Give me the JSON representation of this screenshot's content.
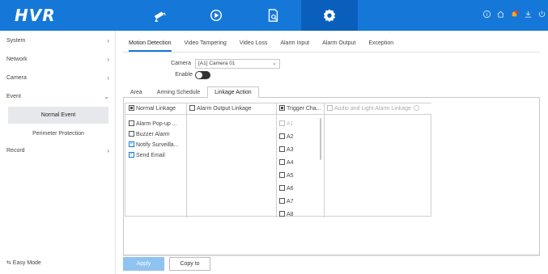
{
  "app": {
    "logo": "HVR"
  },
  "topnav": {
    "items": [
      {
        "icon": "camera-icon",
        "active": false
      },
      {
        "icon": "playback-icon",
        "active": false
      },
      {
        "icon": "file-search-icon",
        "active": false
      },
      {
        "icon": "gear-icon",
        "active": true
      }
    ],
    "right_icons": [
      "info-icon",
      "home-icon",
      "alarm-bell-icon",
      "download-icon",
      "power-icon"
    ]
  },
  "sidebar": {
    "items": [
      {
        "label": "System",
        "chevron": "›"
      },
      {
        "label": "Network",
        "chevron": "›"
      },
      {
        "label": "Camera",
        "chevron": "›"
      },
      {
        "label": "Event",
        "chevron": "⌄"
      },
      {
        "label": "Record",
        "chevron": "›"
      }
    ],
    "subitems": [
      {
        "label": "Normal Event",
        "active": true
      },
      {
        "label": "Perimeter Protection",
        "active": false
      }
    ],
    "easy_mode": "⇆ Easy Mode"
  },
  "main": {
    "tabs": [
      {
        "label": "Motion Detection",
        "active": true
      },
      {
        "label": "Video Tampering",
        "active": false
      },
      {
        "label": "Video Loss",
        "active": false
      },
      {
        "label": "Alarm Input",
        "active": false
      },
      {
        "label": "Alarm Output",
        "active": false
      },
      {
        "label": "Exception",
        "active": false
      }
    ],
    "camera_label": "Camera",
    "camera_value": "[A1] Camera 01",
    "camera_caret": "⌄",
    "enable_label": "Enable",
    "subtabs": [
      {
        "label": "Area",
        "active": false
      },
      {
        "label": "Arming Schedule",
        "active": false
      },
      {
        "label": "Linkage Action",
        "active": true
      }
    ],
    "linkage": {
      "normal_header": "Normal Linkage",
      "alarm_output_header": "Alarm Output Linkage",
      "trigger_header": "Trigger Cha...",
      "audio_header": "Audio and Light Alarm Linkage",
      "normal_items": [
        {
          "label": "Alarm Pop-up ...",
          "checked": false
        },
        {
          "label": "Buzzer Alarm",
          "checked": false
        },
        {
          "label": "Notify Surveilla...",
          "checked": true
        },
        {
          "label": "Send Email",
          "checked": true
        }
      ],
      "channels": [
        {
          "label": "A1",
          "disabled": true
        },
        {
          "label": "A2",
          "disabled": false
        },
        {
          "label": "A3",
          "disabled": false
        },
        {
          "label": "A4",
          "disabled": false
        },
        {
          "label": "A5",
          "disabled": false
        },
        {
          "label": "A6",
          "disabled": false
        },
        {
          "label": "A7",
          "disabled": false
        },
        {
          "label": "A8",
          "disabled": false
        }
      ]
    },
    "buttons": {
      "apply": "Apply",
      "copy": "Copy to"
    }
  },
  "colors": {
    "accent": "#1578d8",
    "active_nav": "#0a5fbd",
    "apply_disabled": "#8fc3f0"
  }
}
